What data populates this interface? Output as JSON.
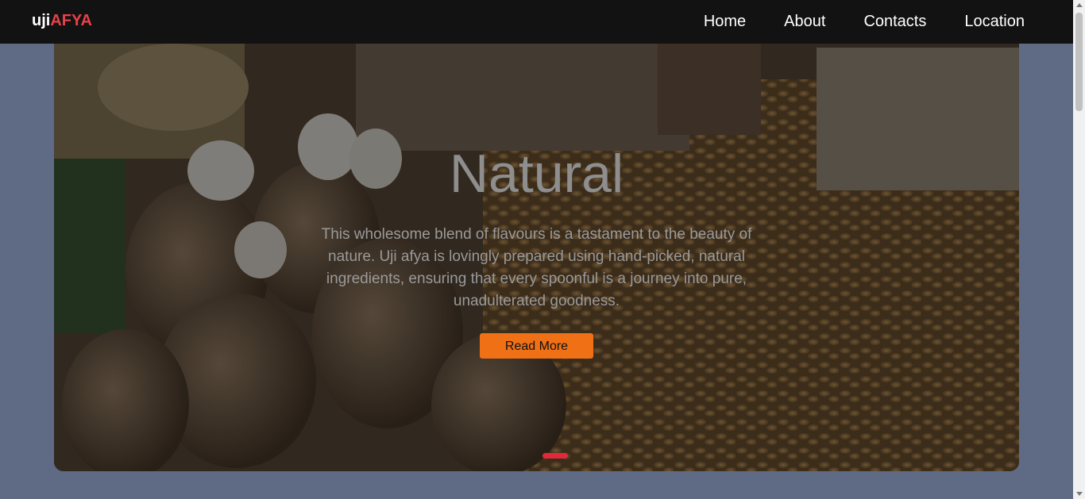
{
  "navbar": {
    "brand_part1": "uji",
    "brand_part2": "AFYA",
    "links": [
      "Home",
      "About",
      "Contacts",
      "Location"
    ]
  },
  "hero": {
    "title": "Natural",
    "text": "This wholesome blend of flavours is a tastament to the beauty of nature. Uji afya is lovingly prepared using hand-picked, natural ingredients, ensuring that every spoonful is a journey into pure, unadulterated goodness.",
    "button_label": "Read More"
  },
  "colors": {
    "page_bg": "#5f6b85",
    "navbar_bg": "#121212",
    "brand_accent": "#e8414b",
    "button_bg": "#f07016",
    "indicator": "#e02a3c"
  }
}
